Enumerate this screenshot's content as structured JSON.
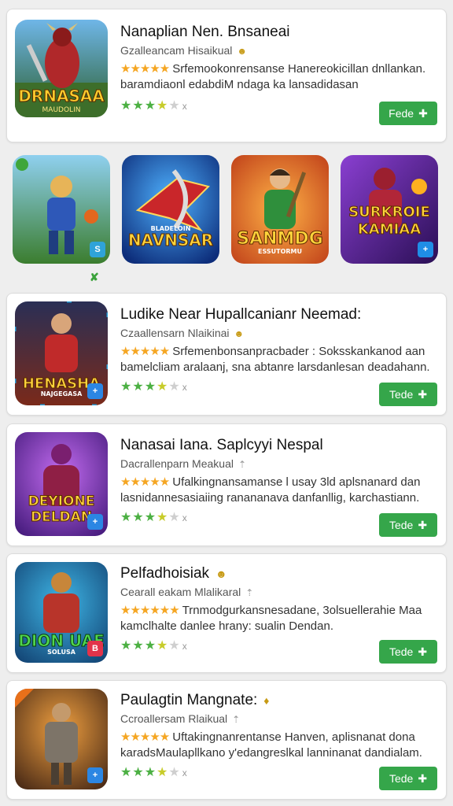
{
  "cards": [
    {
      "title": "Nanaplian Nen. Bnsaneai",
      "developer": "Gzalleancam Hisaikual",
      "description": "Srfemookonrensanse Hanereokicillan dnllankan. baramdiaonl edabdiM ndaga ka lansadidasan loagulestronn.",
      "button": "Fede",
      "thumb_label": "DRNASAA",
      "thumb_sub": "MAUDOLIN",
      "badge": ""
    },
    {
      "title": "Ludike Near Hupallcanianr Neemad:",
      "developer": "Czaallensarn Nlaikinai",
      "description": "Srfemenbonsanpracbader : Soksskankanod aan bamelcliam aralaanj, sna abtanre larsdanlesan deadahann.",
      "button": "Tede",
      "thumb_label": "HENASHA",
      "thumb_sub": "NAJGEGASA",
      "badge": "+"
    },
    {
      "title": "Nanasai Iana. Saplcyyi Nespal",
      "developer": "Dacrallenparn Meakual",
      "description": "Ufalkingnansamanse l usay 3ld aplsnanard dan lasnidannesasiaiing ranananava danfanllig, karchastiann.",
      "button": "Tede",
      "thumb_label": "DEYIONE DELDAN",
      "thumb_sub": "",
      "badge": "+"
    },
    {
      "title": "Pelfadhoisiak",
      "developer": "Cearall eakam Mlalikaral",
      "description": "Trnmodgurkansnesadane, 3olsuellerahie Maa kamclhalte danlee hrany: sualin Dendan.",
      "button": "Tede",
      "thumb_label": "DION UAE",
      "thumb_sub": "SOLUSA",
      "badge": "B"
    },
    {
      "title": "Paulagtin Mangnate:",
      "developer": "Ccroallersam Rlaikual",
      "description": "Uftakingnanrentanse Hanven, aplisnanat dona karadsMaulapllkano y'edangreslkal lanninanat dandialam.",
      "button": "Tede",
      "thumb_label": "",
      "thumb_sub": "",
      "badge": "+"
    }
  ],
  "featured": [
    {
      "label": "",
      "badge": "S"
    },
    {
      "label": "NAVNSAR",
      "sub": "BLADELOIN"
    },
    {
      "label": "SANMDG",
      "sub": "ESSUTORMU"
    },
    {
      "label": "SURKROIE KAMIAA",
      "badge": "+"
    }
  ],
  "rating_suffix": "x",
  "colors": {
    "accent": "#35a64a",
    "star_gold": "#f5a623",
    "star_green": "#4cb043"
  }
}
